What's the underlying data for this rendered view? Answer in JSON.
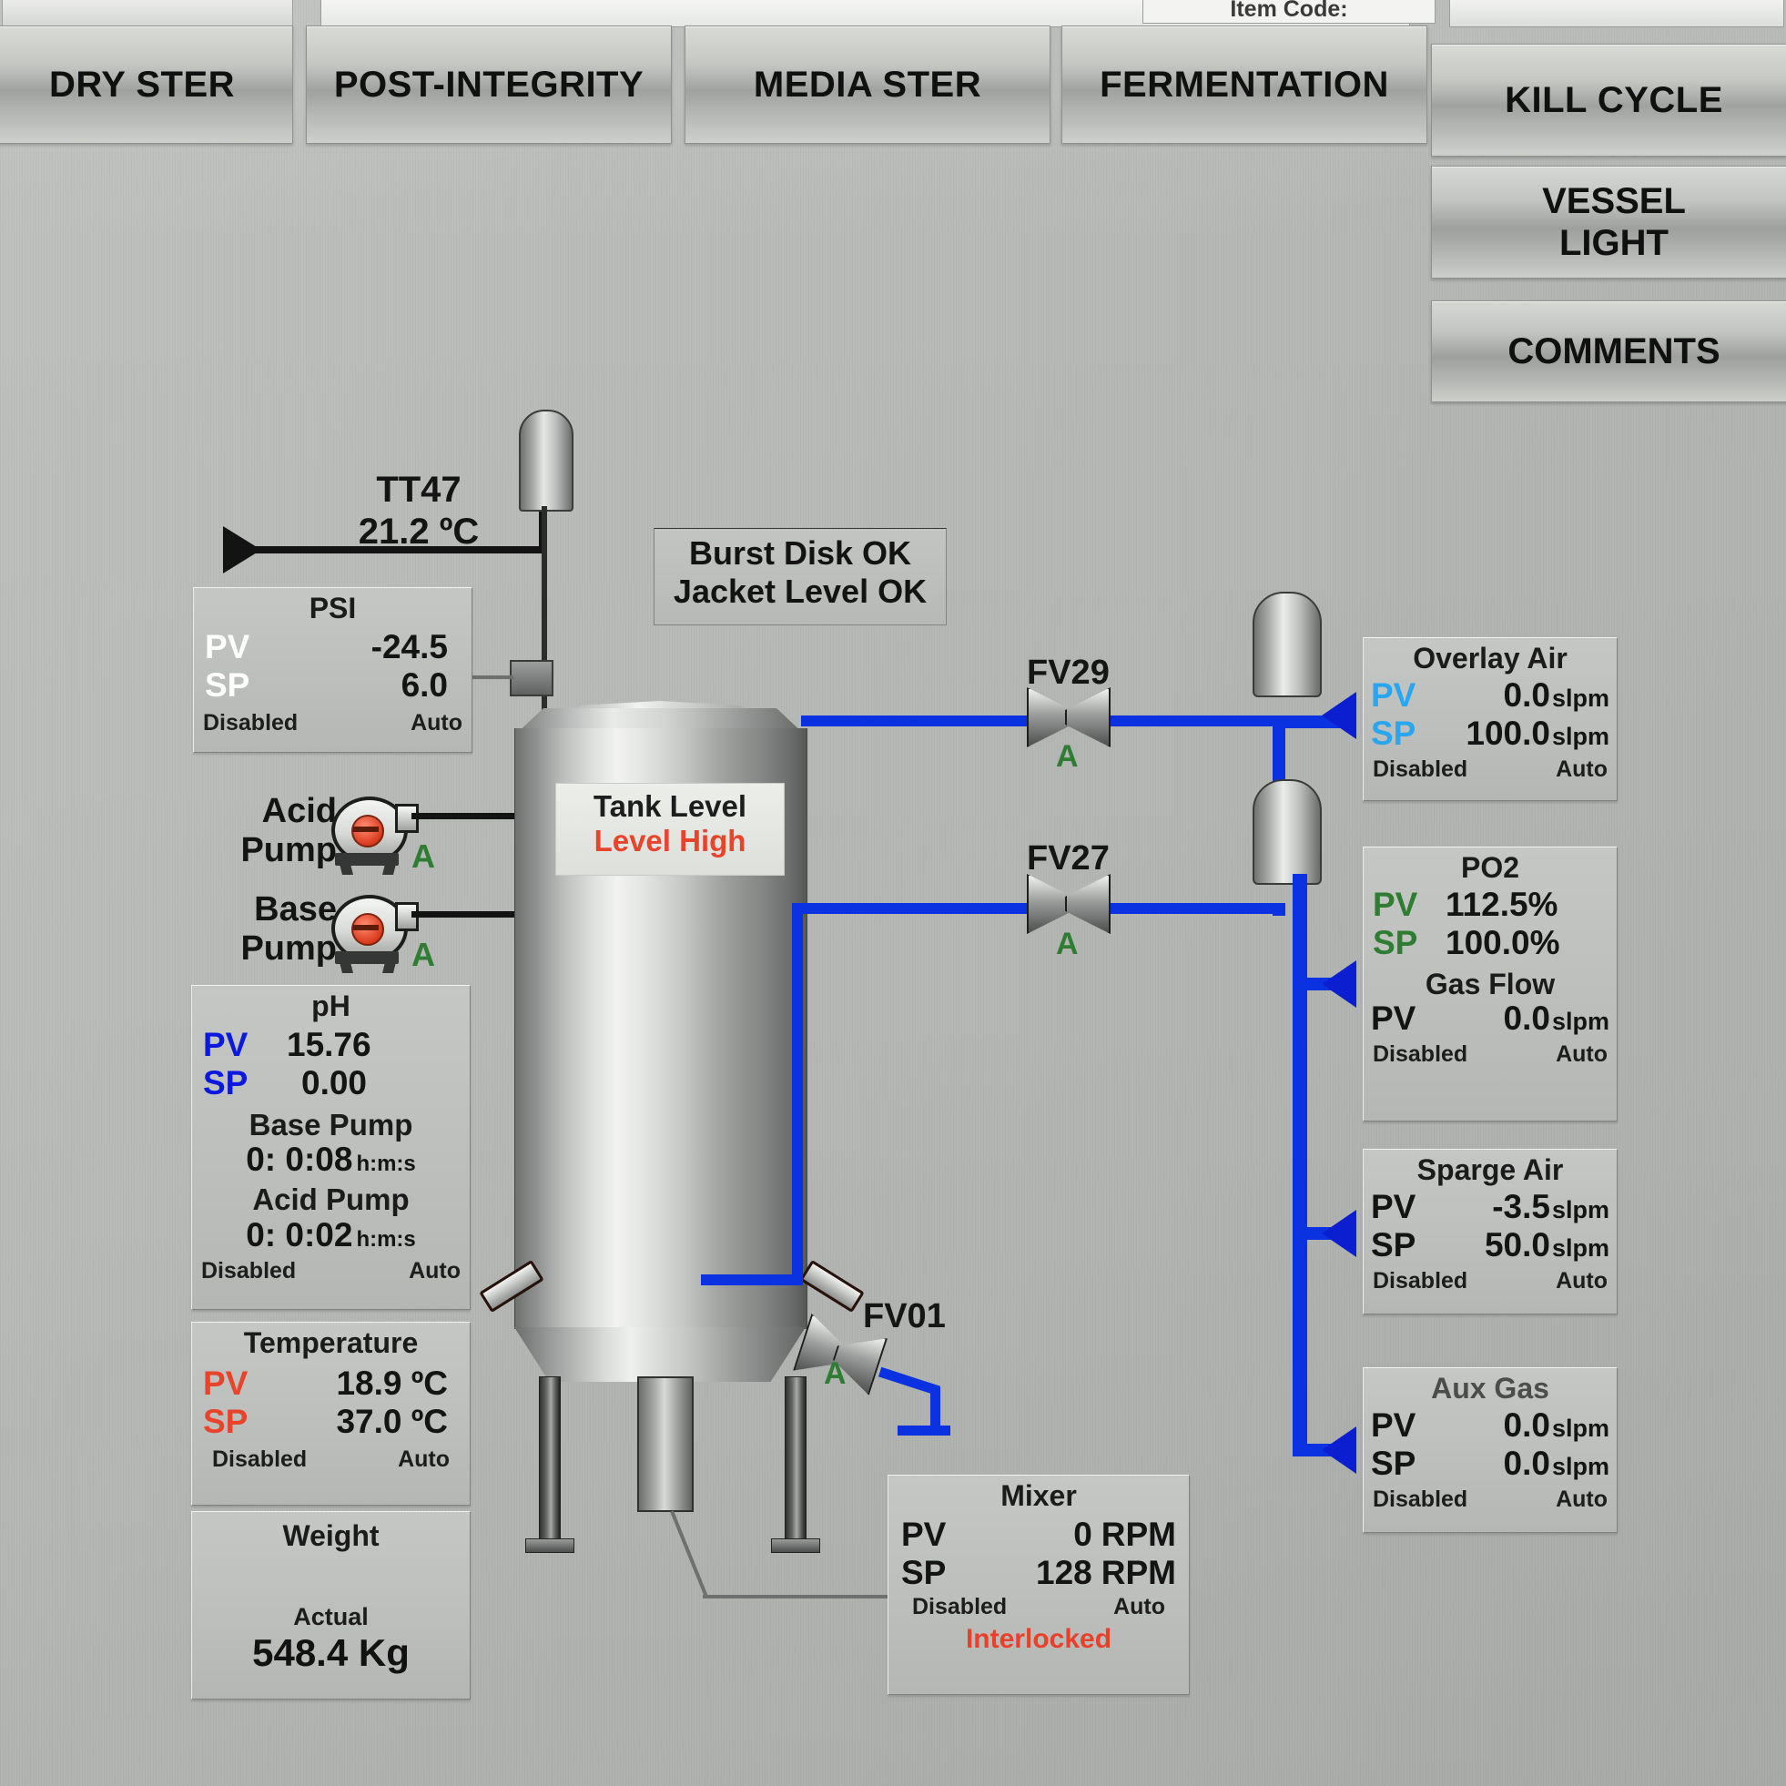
{
  "topbar": {
    "item_code_label": "Item Code:",
    "tabs": [
      {
        "label": "DRY STER"
      },
      {
        "label": "POST-INTEGRITY"
      },
      {
        "label": "MEDIA STER"
      },
      {
        "label": "FERMENTATION"
      },
      {
        "label": "KILL CYCLE"
      }
    ],
    "side_buttons": [
      {
        "label": "VESSEL\nLIGHT",
        "line1": "VESSEL",
        "line2": "LIGHT"
      },
      {
        "label": "COMMENTS",
        "line1": "COMMENTS",
        "line2": ""
      }
    ]
  },
  "transmitter": {
    "tag": "TT47",
    "value": "21.2 ºC"
  },
  "psi": {
    "title": "PSI",
    "pv_label": "PV",
    "pv_value": "-24.5",
    "sp_label": "SP",
    "sp_value": "6.0",
    "enable_state": "Disabled",
    "mode": "Auto"
  },
  "acid_pump": {
    "label_line1": "Acid",
    "label_line2": "Pump",
    "mode": "A"
  },
  "base_pump": {
    "label_line1": "Base",
    "label_line2": "Pump",
    "mode": "A"
  },
  "ph": {
    "title": "pH",
    "pv_label": "PV",
    "pv_value": "15.76",
    "sp_label": "SP",
    "sp_value": "0.00",
    "base_pump_title": "Base Pump",
    "base_pump_time": "0:  0:08",
    "base_pump_units": "h:m:s",
    "acid_pump_title": "Acid Pump",
    "acid_pump_time": "0:  0:02",
    "acid_pump_units": "h:m:s",
    "enable_state": "Disabled",
    "mode": "Auto"
  },
  "temperature": {
    "title": "Temperature",
    "pv_label": "PV",
    "pv_value": "18.9 ºC",
    "sp_label": "SP",
    "sp_value": "37.0 ºC",
    "enable_state": "Disabled",
    "mode": "Auto"
  },
  "weight": {
    "title": "Weight",
    "actual_label": "Actual",
    "actual_value": "548.4 Kg"
  },
  "alarms": {
    "burst_disk": "Burst Disk OK",
    "jacket_level": "Jacket Level OK"
  },
  "tank_level": {
    "title": "Tank Level",
    "status": "Level High"
  },
  "valves": {
    "fv29": {
      "tag": "FV29",
      "mode": "A"
    },
    "fv27": {
      "tag": "FV27",
      "mode": "A"
    },
    "fv01": {
      "tag": "FV01",
      "mode": "A"
    }
  },
  "overlay_air": {
    "title": "Overlay Air",
    "pv_label": "PV",
    "pv_value": "0.0",
    "pv_unit": "slpm",
    "sp_label": "SP",
    "sp_value": "100.0",
    "sp_unit": "slpm",
    "enable_state": "Disabled",
    "mode": "Auto"
  },
  "po2": {
    "title": "PO2",
    "pv_label": "PV",
    "pv_value": "112.5%",
    "sp_label": "SP",
    "sp_value": "100.0%",
    "gas_flow_title": "Gas Flow",
    "gas_flow_pv_label": "PV",
    "gas_flow_pv_value": "0.0",
    "gas_flow_pv_unit": "slpm",
    "enable_state": "Disabled",
    "mode": "Auto"
  },
  "sparge_air": {
    "title": "Sparge Air",
    "pv_label": "PV",
    "pv_value": "-3.5",
    "pv_unit": "slpm",
    "sp_label": "SP",
    "sp_value": "50.0",
    "sp_unit": "slpm",
    "enable_state": "Disabled",
    "mode": "Auto"
  },
  "aux_gas": {
    "title": "Aux Gas",
    "pv_label": "PV",
    "pv_value": "0.0",
    "pv_unit": "slpm",
    "sp_label": "SP",
    "sp_value": "0.0",
    "sp_unit": "slpm",
    "enable_state": "Disabled",
    "mode": "Auto"
  },
  "mixer": {
    "title": "Mixer",
    "pv_label": "PV",
    "pv_value": "0",
    "pv_unit": "RPM",
    "sp_label": "SP",
    "sp_value": "128",
    "sp_unit": "RPM",
    "enable_state": "Disabled",
    "mode": "Auto",
    "interlock_status": "Interlocked"
  },
  "colors": {
    "pipe_blue": "#0b32e0",
    "alarm_red": "#e8442c",
    "mode_green": "#2e7d32",
    "label_blue": "#0a18e0",
    "overlay_cyan": "#2aa6f0",
    "gas_flow_brown": "#8a5a33",
    "panel_bg": "#bdc0bc"
  }
}
